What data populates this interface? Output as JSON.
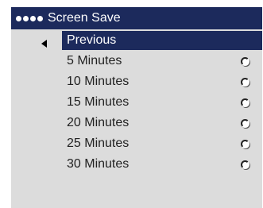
{
  "menu": {
    "title": "Screen Save",
    "back_item": "Previous",
    "options": [
      {
        "label": "5 Minutes",
        "selected": false
      },
      {
        "label": "10 Minutes",
        "selected": false
      },
      {
        "label": "15 Minutes",
        "selected": false
      },
      {
        "label": "20 Minutes",
        "selected": false
      },
      {
        "label": "25 Minutes",
        "selected": false
      },
      {
        "label": "30 Minutes",
        "selected": false
      }
    ]
  },
  "colors": {
    "title_bg": "#1c2a5c",
    "menu_bg": "#dcdcdc",
    "highlight": "#1c2a5c"
  },
  "icons": {
    "title_dots": "four-dot-indicator-icon",
    "back": "left-arrow-icon",
    "option": "radio-button-icon"
  }
}
